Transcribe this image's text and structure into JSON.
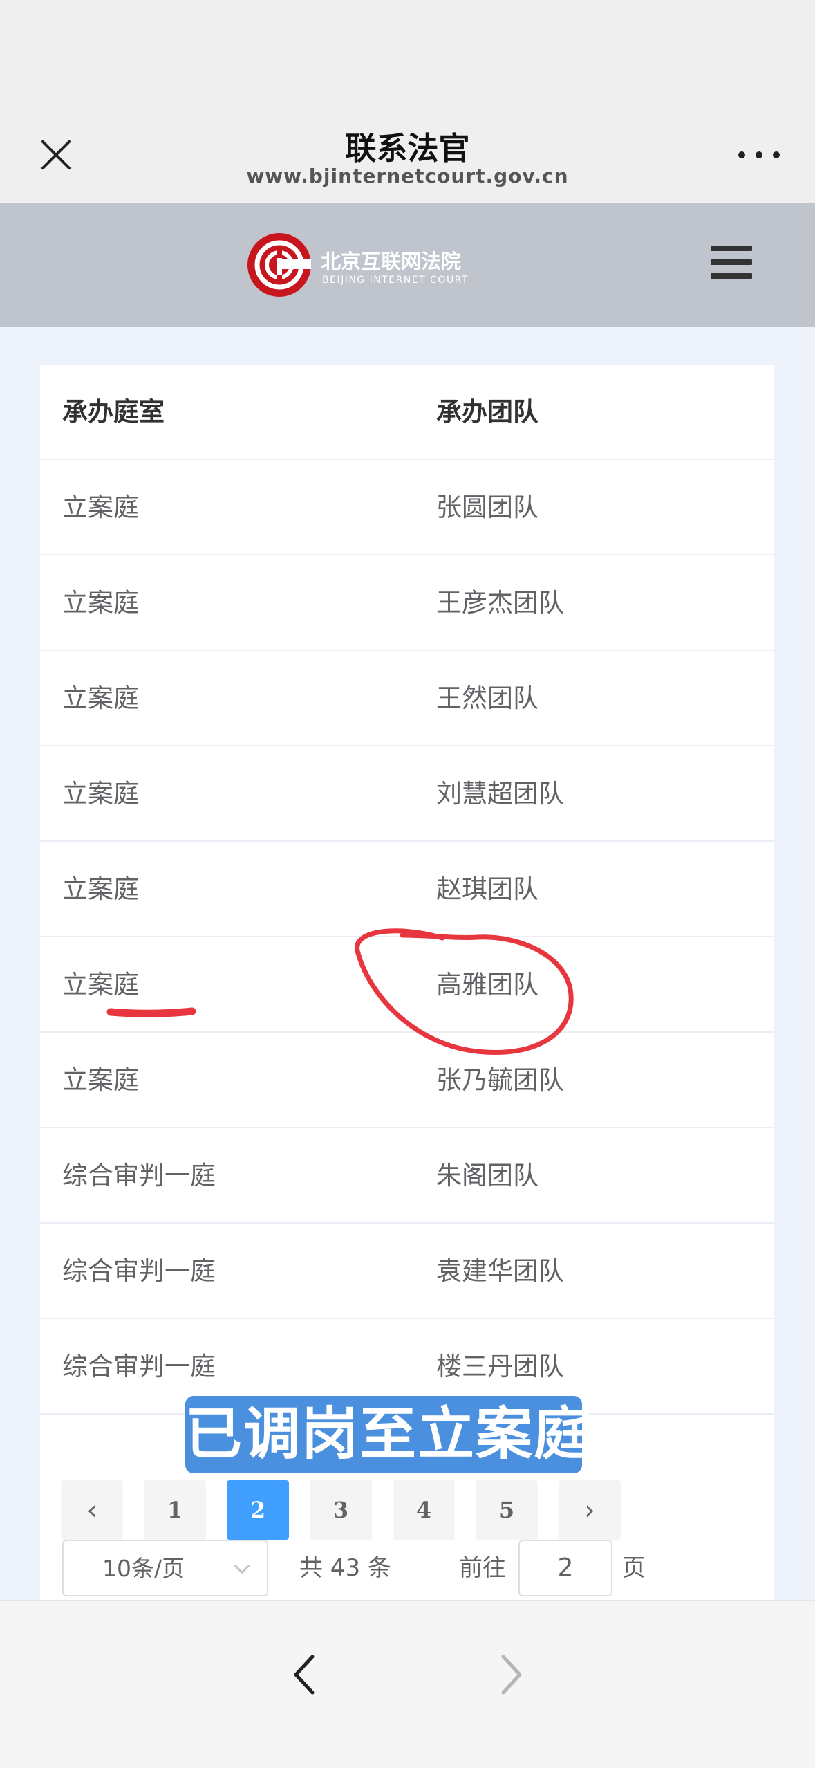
{
  "topbar": {
    "title": "联系法官",
    "url": "www.bjinternetcourt.gov.cn"
  },
  "header": {
    "logo_cn": "北京互联网法院",
    "logo_en": "BEIJING INTERNET COURT",
    "accent": "#c8161e"
  },
  "table": {
    "columns": [
      "承办庭室",
      "承办团队"
    ],
    "rows": [
      [
        "立案庭",
        "张圆团队"
      ],
      [
        "立案庭",
        "王彦杰团队"
      ],
      [
        "立案庭",
        "王然团队"
      ],
      [
        "立案庭",
        "刘慧超团队"
      ],
      [
        "立案庭",
        "赵琪团队"
      ],
      [
        "立案庭",
        "高雅团队"
      ],
      [
        "立案庭",
        "张乃毓团队"
      ],
      [
        "综合审判一庭",
        "朱阁团队"
      ],
      [
        "综合审判一庭",
        "袁建华团队"
      ],
      [
        "综合审判一庭",
        "楼三丹团队"
      ]
    ]
  },
  "caption": "已调岗至立案庭",
  "annotation_color": "#e8363f",
  "pagination": {
    "pages": [
      "1",
      "2",
      "3",
      "4",
      "5"
    ],
    "prev": "‹",
    "next": "›",
    "current": "2",
    "page_size": "10条/页",
    "total": "共 43 条",
    "goto_label": "前往",
    "goto_value": "2",
    "goto_unit": "页",
    "active_color": "#409eff"
  }
}
